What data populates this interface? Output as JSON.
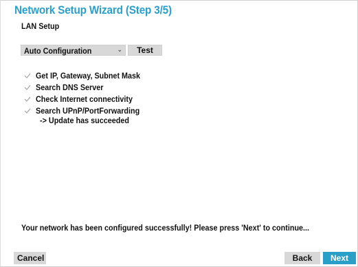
{
  "wizard": {
    "title": "Network Setup Wizard (Step 3/5)",
    "subtitle": "LAN Setup"
  },
  "config": {
    "mode_value": "Auto Configuration",
    "test_label": "Test"
  },
  "steps": [
    {
      "label": "Get IP, Gateway, Subnet Mask",
      "icon": "check-icon"
    },
    {
      "label": "Search DNS Server",
      "icon": "check-icon"
    },
    {
      "label": "Check Internet connectivity",
      "icon": "check-icon"
    },
    {
      "label": "Search UPnP/PortForwarding",
      "icon": "check-icon"
    }
  ],
  "result": "-> Update has succeeded",
  "message": "Your network has been configured successfully! Please press 'Next' to continue...",
  "footer": {
    "cancel_label": "Cancel",
    "back_label": "Back",
    "next_label": "Next"
  },
  "colors": {
    "accent": "#2aa0c9",
    "button_bg": "#d8d8d8"
  }
}
